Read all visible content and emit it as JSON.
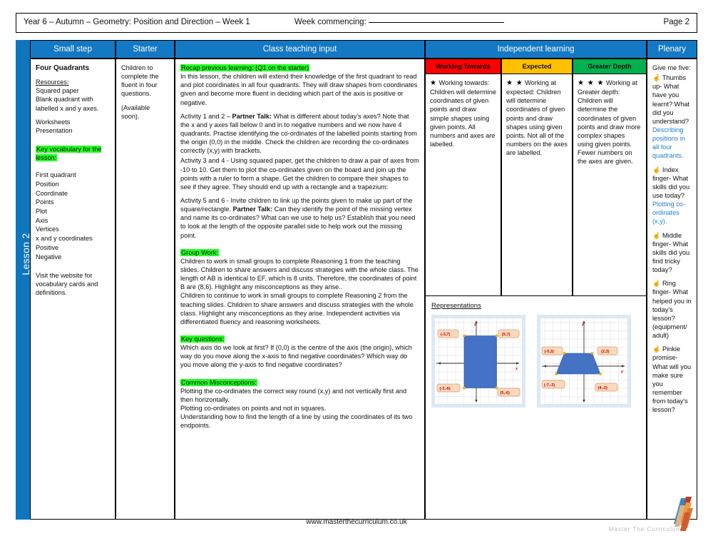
{
  "header": {
    "left": "Year 6 – Autumn – Geometry: Position and Direction  – Week 1",
    "middle": "Week commencing:",
    "page": "Page 2"
  },
  "spine": {
    "label": "Lesson 2"
  },
  "columns": {
    "small_step": "Small step",
    "starter": "Starter",
    "class_teaching": "Class teaching input",
    "independent": "Independent learning",
    "plenary": "Plenary"
  },
  "small_step": {
    "title": "Four Quadrants",
    "resources_label": "Resources:",
    "resources": [
      "Squared paper",
      "Blank quadrant with labelled x and y axes."
    ],
    "materials": [
      "Worksheets",
      "Presentation"
    ],
    "vocab_heading": "Key vocabulary for the lesson:",
    "vocab": [
      "First quadrant",
      "Position",
      "Coordinate",
      "Points",
      "Plot",
      "Axis",
      "Vertices",
      "x and y coordinates",
      "Positive",
      "Negative"
    ],
    "footer_note": "Visit the website for vocabulary cards and definitions."
  },
  "starter": {
    "line1": "Children to complete the fluent in four questions.",
    "line2": "(Available soon)."
  },
  "class_teaching": {
    "recap_heading": "Recap previous learning: (Q1 on the starter)",
    "recap_body": "In this lesson, the children will extend their knowledge of the first quadrant to read and plot coordinates in all four quadrants. They will draw shapes from coordinates given and become more fluent in deciding which part of the axis is positive or negative.",
    "activity12_prefix": "Activity 1 and 2 – ",
    "partner_talk": "Partner Talk:",
    "activity12_body": " What is different about today's axes? Note that the x and y axes fall below 0 and in to negative numbers and we now have 4 quadrants. Practise identifying the co-ordinates of the labelled points starting from the origin (0,0) in the middle. Check the children are recording the co-ordinates correctly (x,y) with brackets.",
    "activity34": "Activity 3 and 4 -  Using squared paper, get the children to draw a pair of axes  from -10 to 10. Get them to plot the co-ordinates given on the board and join up the points with a ruler to form a shape. Get the children to compare their shapes to see if they agree.  They should end up with a rectangle and a trapezium:",
    "activity56_prefix": "Activity 5 and 6 -  Invite children to link up the  points given to make up part of the square/rectangle. ",
    "activity56_body": " Can they identify the point of the missing vertex and name its co-ordinates? What can we use to help us? Establish that you need to look at the length of the opposite parallel side to help work out the missing point.",
    "group_work_heading": "Group Work:",
    "group_work_body1": "Children to work in small groups to complete Reasoning 1 from the teaching slides. Children to share answers and discuss strategies with the whole class. The length of AB is identical to EF, which is 8 units. Therefore, the coordinates of point B are (8,6). Highlight any misconceptions as they arise..",
    "group_work_body2": "Children to continue to work in small groups to complete Reasoning 2 from the teaching slides. Children to share answers and discuss strategies with the whole class. Highlight any misconceptions as they arise. Independent activities via differentiated fluency and reasoning worksheets.",
    "key_questions_heading": "Key questions:",
    "key_questions_body": "Which axis do we look at first? If (0,0) is the centre of the axis (the origin), which way do you move along the x-axis to find negative coordinates? Which way do you move along the y-axis to find negative coordinates?",
    "misconceptions_heading": "Common Misconceptions:",
    "misconceptions_body1": "Plotting the co-ordinates the correct way round (x,y) and not vertically first and then horizontally.",
    "misconceptions_body2": "Plotting co-ordinates on points and not in squares.",
    "misconceptions_body3": "Understanding how to find the length of a line by using the coordinates of its two endpoints."
  },
  "independent": {
    "bands": [
      {
        "label": "Working Towards",
        "color": "#ff0000",
        "stars": "★",
        "heading": "Working towards:",
        "body": "Children will determine coordinates of given points and draw simple shapes using given points. All numbers and axes are labelled."
      },
      {
        "label": "Expected",
        "color": "#ffc000",
        "stars": "★ ★",
        "heading": "Working at expected:",
        "body": "Children will determine coordinates of given points and draw shapes using given points. Not all of the numbers on the axes are labelled."
      },
      {
        "label": "Greater Depth",
        "color": "#00b050",
        "stars": "★ ★ ★",
        "heading": "Working at Greater depth:",
        "body": "Children will determine the coordinates of given points and draw more complex shapes using given points. Fewer numbers on the axes are given."
      }
    ],
    "representations_title": "Representations"
  },
  "plenary": {
    "intro": "Give me five:",
    "items": [
      {
        "icon": "hand-icon",
        "text": "Thumbs up- What have you learnt? What did you understand? ",
        "answer": "Describing positions in all four quadrants."
      },
      {
        "icon": "hand-icon",
        "text": "Index finger- What skills did you use today? ",
        "answer": "Plotting co-ordinates (x,y)."
      },
      {
        "icon": "hand-icon",
        "text": "Middle finger- What skills did you find tricky today?",
        "answer": ""
      },
      {
        "icon": "hand-icon",
        "text": "Ring finger- What helped you in today's lesson? (equipment/ adult)",
        "answer": ""
      },
      {
        "icon": "hand-icon",
        "text": "Pinkie promise- What will you make sure you remember from today's lesson?",
        "answer": ""
      }
    ]
  },
  "chart_data": [
    {
      "type": "scatter",
      "title": "Rectangle in four quadrants",
      "xlabel": "x",
      "ylabel": "y",
      "xlim": [
        -10,
        10
      ],
      "ylim": [
        -10,
        10
      ],
      "grid": true,
      "shape": "rectangle",
      "points": [
        {
          "label": "(-3,7)",
          "x": -3,
          "y": 7
        },
        {
          "label": "(5,7)",
          "x": 5,
          "y": 7
        },
        {
          "label": "(-3,-6)",
          "x": -3,
          "y": -6
        },
        {
          "label": "(5,-6)",
          "x": 5,
          "y": -6
        }
      ],
      "fill": "#4472c4"
    },
    {
      "type": "scatter",
      "title": "Trapezium in four quadrants",
      "xlabel": "y",
      "ylabel": "y",
      "xlim": [
        -10,
        10
      ],
      "ylim": [
        -10,
        10
      ],
      "grid": true,
      "shape": "trapezium",
      "points": [
        {
          "label": "(-5,3)",
          "x": -5,
          "y": 3
        },
        {
          "label": "(2,3)",
          "x": 2,
          "y": 3
        },
        {
          "label": "(-7,-2)",
          "x": -7,
          "y": -2
        },
        {
          "label": "(4,-2)",
          "x": 4,
          "y": -2
        }
      ],
      "fill": "#4472c4"
    }
  ],
  "footer": {
    "url": "www.masterthecurriculum.co.uk",
    "logo_text": "Master  The  Curriculum"
  }
}
